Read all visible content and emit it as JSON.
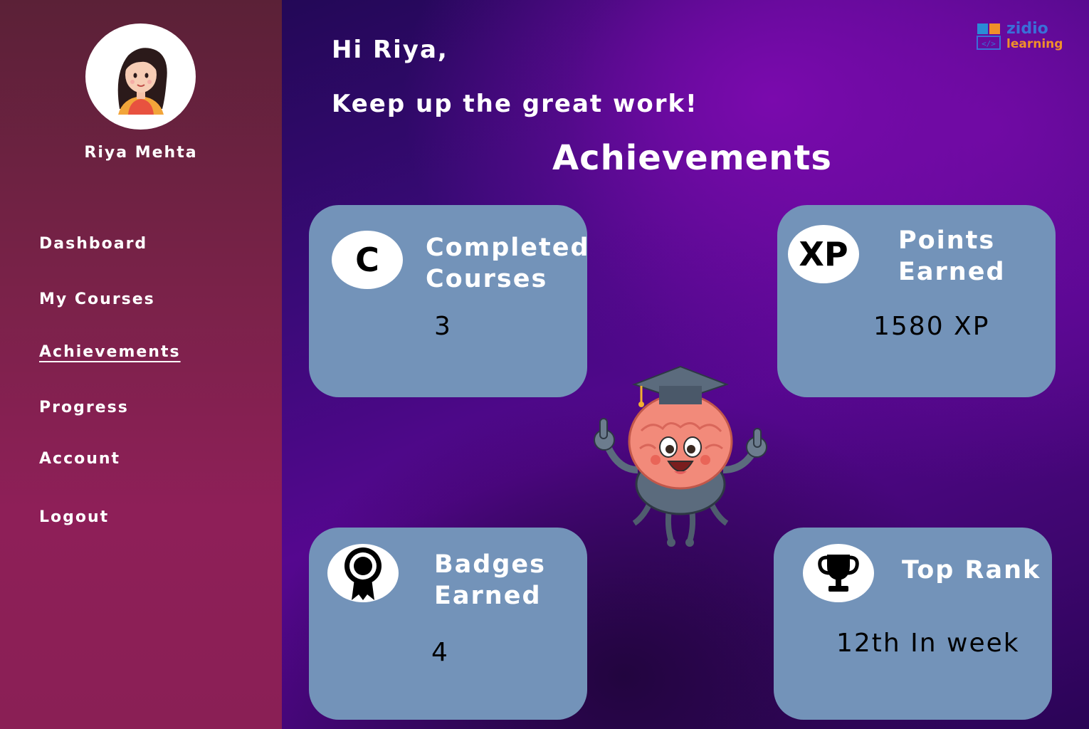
{
  "user": {
    "name": "Riya Mehta"
  },
  "nav": {
    "items": [
      {
        "label": "Dashboard",
        "active": false
      },
      {
        "label": "My Courses",
        "active": false
      },
      {
        "label": "Achievements",
        "active": true
      },
      {
        "label": "Progress",
        "active": false
      },
      {
        "label": "Account",
        "active": false
      },
      {
        "label": "Logout",
        "active": false
      }
    ]
  },
  "header": {
    "greeting": "Hi Riya,",
    "motivation": "Keep up the great work!",
    "section_title": "Achievements"
  },
  "logo": {
    "line1": "zidio",
    "line2": "learning"
  },
  "cards": {
    "completed": {
      "icon_text": "C",
      "label_line1": "Completed",
      "label_line2": "Courses",
      "value": "3"
    },
    "points": {
      "icon_text": "XP",
      "label_line1": "Points",
      "label_line2": "Earned",
      "value": "1580 XP"
    },
    "badges": {
      "icon": "badge-ribbon-icon",
      "label_line1": "Badges",
      "label_line2": "Earned",
      "value": "4"
    },
    "rank": {
      "icon": "trophy-icon",
      "label": "Top Rank",
      "value": "12th In week"
    }
  },
  "colors": {
    "sidebar": "#7a2249",
    "card": "#7393b9",
    "accent_blue": "#3a6fd8",
    "accent_orange": "#f0902a"
  }
}
